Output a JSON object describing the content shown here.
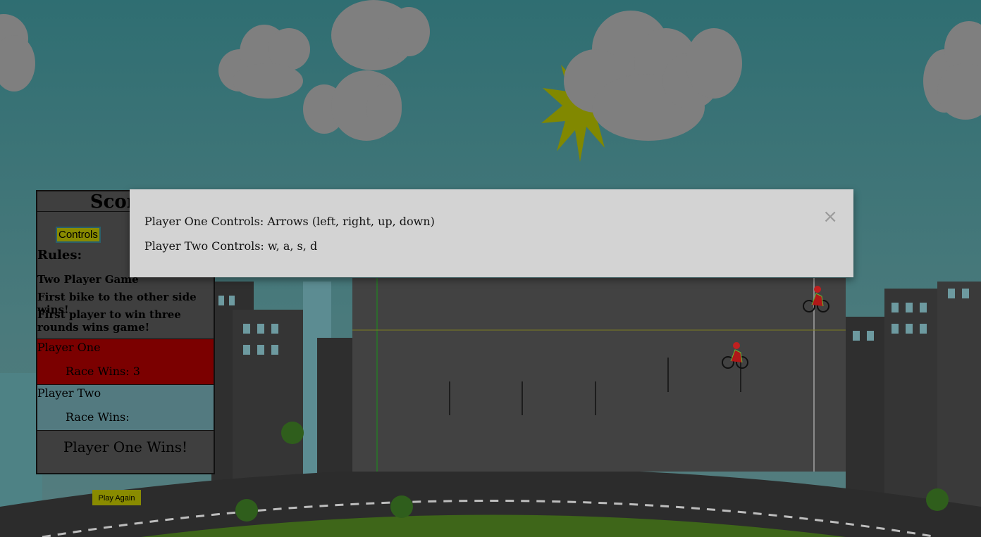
{
  "scoreboard": {
    "title": "Scoreb",
    "controls_label": "Controls",
    "rules_heading": "Rules:",
    "rules": [
      "Two Player Game",
      "First bike to the other side wins!",
      "First player to win three rounds wins game!"
    ],
    "player_one": {
      "name": "Player One",
      "race_wins_label": "Race Wins: 3",
      "color": "#7b0000"
    },
    "player_two": {
      "name": "Player Two",
      "race_wins_label": "Race Wins:",
      "color": "#537a80"
    },
    "winner_text": "Player One Wins!"
  },
  "play_again_label": "Play Again",
  "modal": {
    "line1": "Player One Controls: Arrows (left, right, up, down)",
    "line2": "Player Two Controls: w, a, s, d",
    "close_label": "×"
  },
  "colors": {
    "accent": "#898b00",
    "track": "#424242",
    "sky": "#3a6f72"
  }
}
